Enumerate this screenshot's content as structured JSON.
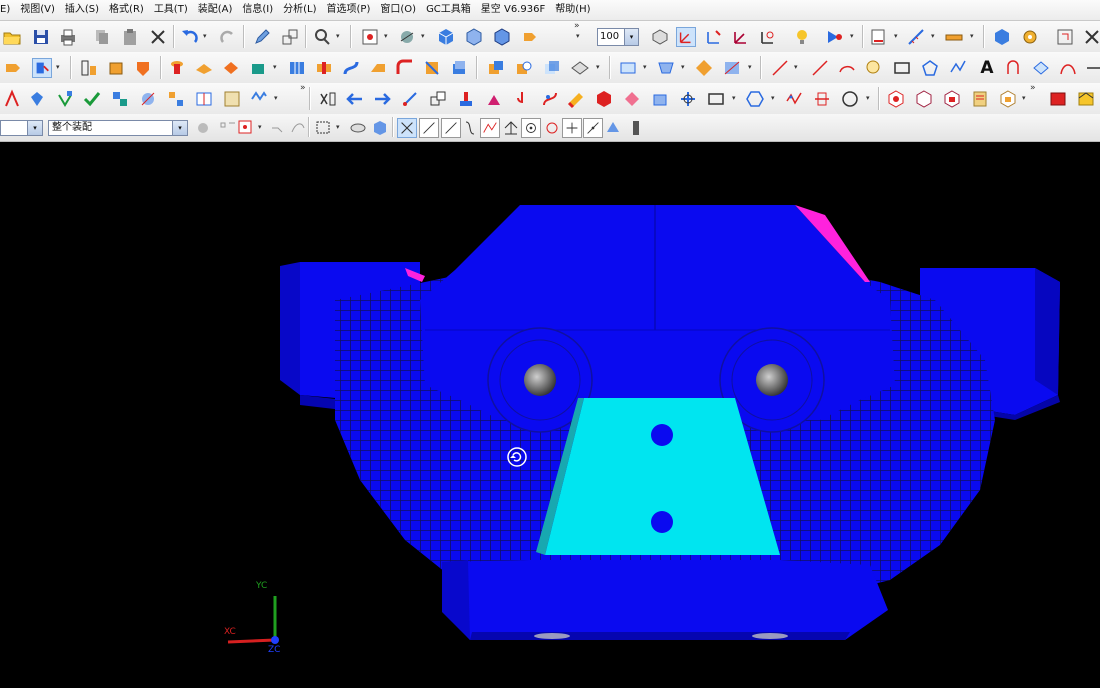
{
  "menu": {
    "items": [
      "E)",
      "视图(V)",
      "插入(S)",
      "格式(R)",
      "工具(T)",
      "装配(A)",
      "信息(I)",
      "分析(L)",
      "首选项(P)",
      "窗口(O)",
      "GC工具箱",
      "星空 V6.936F",
      "帮助(H)"
    ]
  },
  "toolbar": {
    "zoom_value": "100",
    "layer_filter": "",
    "selection_scope": "整个装配",
    "overflow_glyph": "»",
    "dropdown_glyph": "▾",
    "text_tool_glyph": "A"
  },
  "viewport": {
    "background": "#000000",
    "part_colors": {
      "body": "#0a0af0",
      "face_highlight": "#00e5f0",
      "edge_highlight": "#ff22dd",
      "grid_lines": "#111155"
    },
    "triad": {
      "x_label": "XC",
      "y_label": "YC",
      "z_label": "ZC",
      "x_color": "#d62020",
      "y_color": "#20a020",
      "z_color": "#2040ff"
    },
    "rotate_cursor": "rotate-cursor-icon"
  }
}
